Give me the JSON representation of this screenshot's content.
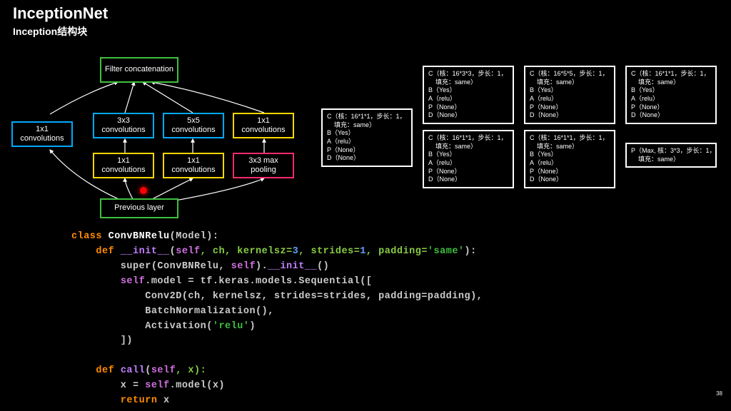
{
  "title": "InceptionNet",
  "subtitle": "Inception结构块",
  "page_number": "38",
  "diagram": {
    "filter_concat": "Filter\nconcatenation",
    "conv1x1_left": "1x1\nconvolutions",
    "conv3x3": "3x3\nconvolutions",
    "conv5x5": "5x5\nconvolutions",
    "conv1x1_top": "1x1\nconvolutions",
    "conv1x1_a": "1x1\nconvolutions",
    "conv1x1_b": "1x1\nconvolutions",
    "maxpool": "3x3 max\npooling",
    "prev": "Previous layer"
  },
  "info": {
    "left": "C（核：16*1*1，步长：1，\n    填充：same）\nB（Yes）\nA（relu）\nP（None）\nD（None）",
    "t0": "C（核：16*3*3，步长：1，\n    填充：same）\nB（Yes）\nA（relu）\nP（None）\nD（None）",
    "t1": "C（核：16*5*5，步长：1，\n    填充：same）\nB（Yes）\nA（relu）\nP（None）\nD（None）",
    "t2": "C（核：16*1*1，步长：1，\n    填充：same）\nB（Yes）\nA（relu）\nP（None）\nD（None）",
    "b0": "C（核：16*1*1，步长：1，\n    填充：same）\nB（Yes）\nA（relu）\nP（None）\nD（None）",
    "b1": "C（核：16*1*1，步长：1，\n    填充：same）\nB（Yes）\nA（relu）\nP（None）\nD（None）",
    "b2": "P（Max, 核：3*3，步长：1，\n    填充：same）"
  },
  "code": {
    "l0a": "class ",
    "l0b": "ConvBNRelu",
    "l0c": "(Model):",
    "l1a": "    def ",
    "l1b": "__init__",
    "l1c": "(",
    "l1s": "self",
    "l1d": ", ch, kernelsz=",
    "l1n3": "3",
    "l1e": ", strides=",
    "l1n1": "1",
    "l1f": ", padding=",
    "l1g": "'same'",
    "l1h": "):",
    "l2a": "        super(ConvBNRelu, ",
    "l2s": "self",
    "l2b": ").",
    "l2c": "__init__",
    "l2d": "()",
    "l3a": "        ",
    "l3s": "self",
    "l3b": ".model = tf.keras.models.Sequential([",
    "l4a": "            Conv2D(ch, kernelsz, strides=strides, padding=padding),",
    "l5a": "            BatchNormalization(),",
    "l6a": "            Activation(",
    "l6b": "'relu'",
    "l6c": ")",
    "l7a": "        ])",
    "l8": "",
    "l9a": "    def ",
    "l9b": "call",
    "l9c": "(",
    "l9s": "self",
    "l9d": ", x):",
    "l10a": "        x = ",
    "l10s": "self",
    "l10b": ".model(x)",
    "l11a": "        return ",
    "l11b": "x"
  }
}
